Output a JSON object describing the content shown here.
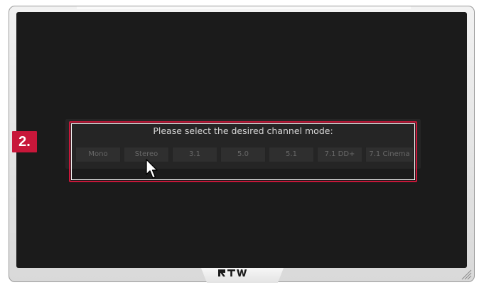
{
  "dialog": {
    "title": "Please select the desired channel mode:",
    "modes": [
      {
        "label": "Mono"
      },
      {
        "label": "Stereo"
      },
      {
        "label": "3.1"
      },
      {
        "label": "5.0"
      },
      {
        "label": "5.1"
      },
      {
        "label": "7.1 DD+"
      },
      {
        "label": "7.1 Cinema"
      }
    ]
  },
  "annotation": {
    "step_label": "2.",
    "accent_color": "#c8173a"
  },
  "brand": {
    "name": "RTW"
  },
  "icons": {
    "pointer": "mouse-pointer-icon",
    "grip": "resize-grip-icon"
  }
}
